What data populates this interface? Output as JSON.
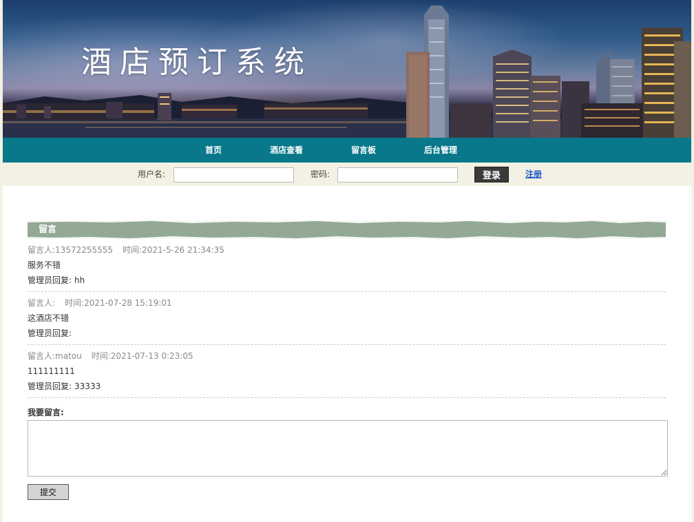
{
  "banner": {
    "title": "酒店预订系统"
  },
  "nav": {
    "items": [
      {
        "label": "首页"
      },
      {
        "label": "酒店查看"
      },
      {
        "label": "留言板"
      },
      {
        "label": "后台管理"
      }
    ]
  },
  "login": {
    "username_label": "用户名:",
    "username_value": "",
    "password_label": "密码:",
    "password_value": "",
    "login_button": "登录",
    "register_link": "注册"
  },
  "board": {
    "section_title": "留言",
    "author_prefix": "留言人:",
    "time_prefix": "时间:",
    "reply_prefix": "管理员回复:",
    "messages": [
      {
        "author": "13572255555",
        "time": "2021-5-26 21:34:35",
        "content": "服务不错",
        "reply": "hh"
      },
      {
        "author": "",
        "time": "2021-07-28 15:19:01",
        "content": "这酒店不错",
        "reply": ""
      },
      {
        "author": "matou",
        "time": "2021-07-13 0:23:05",
        "content": "111111111",
        "reply": "33333"
      }
    ]
  },
  "compose": {
    "label": "我要留言:",
    "value": "",
    "submit_button": "提交"
  },
  "colors": {
    "nav_bg": "#08788a",
    "login_bar_bg": "#f3f1e4",
    "section_bar_bg": "#93a995",
    "link": "#1a55c8"
  }
}
